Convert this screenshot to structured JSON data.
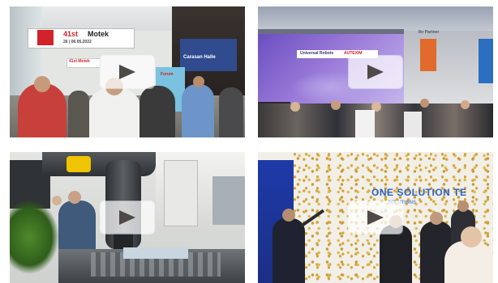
{
  "videos": [
    {
      "scene": "exhibition hall entrance walkway",
      "signs": {
        "edition": "41st",
        "brand": "Motek",
        "date": "26 | 06.05.2022",
        "small_booth": "41st Motek",
        "screen": "Forum"
      },
      "play_icon": "play-icon"
    },
    {
      "scene": "exhibition booth crowd",
      "signs": {
        "booth_left": "Universal Robots",
        "booth_right": "AUTEXIM",
        "banner": "Ihr Partner"
      },
      "play_icon": "play-icon"
    },
    {
      "scene": "robot arm conveyor demo",
      "signs": {},
      "play_icon": "play-icon"
    },
    {
      "scene": "confetti stage opening",
      "signs": {
        "wall": "ONE SOLUTION TE",
        "wall_sub": "SOLUTIONS"
      },
      "play_icon": "play-icon"
    }
  ],
  "colors": {
    "motek_red": "#d2232a",
    "booth_purple": "#6a4fc0",
    "robot_yellow": "#f0c400",
    "stage_blue": "#1e3aa8",
    "confetti_gold": "#d4a53a"
  }
}
